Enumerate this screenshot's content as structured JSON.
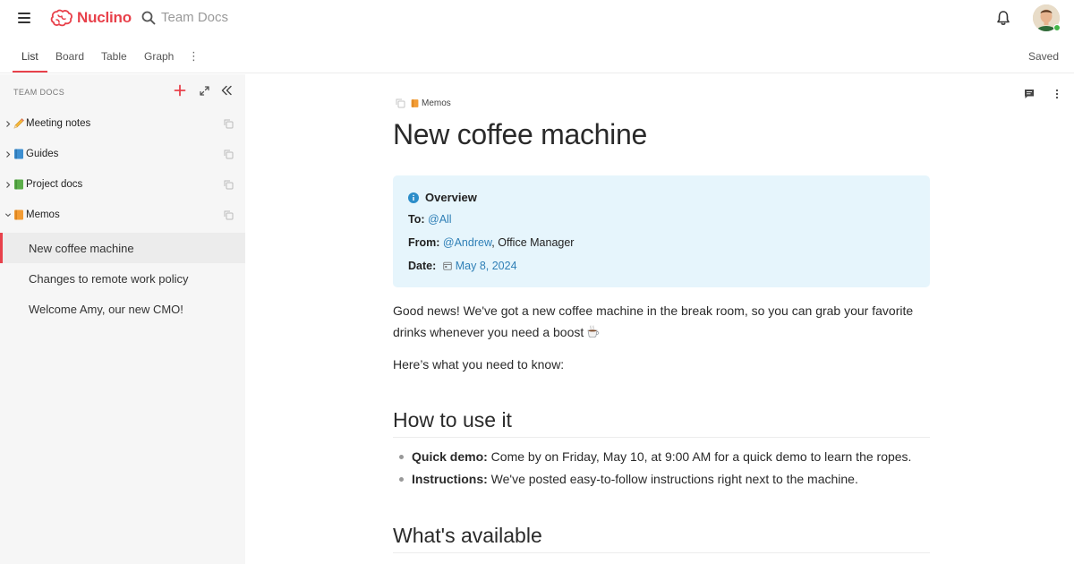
{
  "app": {
    "name": "Nuclino",
    "workspace": "Team Docs",
    "brand_color": "#e8414b"
  },
  "tabs": [
    {
      "label": "List",
      "active": true
    },
    {
      "label": "Board",
      "active": false
    },
    {
      "label": "Table",
      "active": false
    },
    {
      "label": "Graph",
      "active": false
    }
  ],
  "tabs_more": "⋮",
  "save_status": "Saved",
  "sidebar": {
    "title": "TEAM DOCS",
    "collections": [
      {
        "label": "Meeting notes",
        "icon": "pencil-icon",
        "expanded": false
      },
      {
        "label": "Guides",
        "icon": "blue-book-icon",
        "expanded": false
      },
      {
        "label": "Project docs",
        "icon": "green-book-icon",
        "expanded": false
      },
      {
        "label": "Memos",
        "icon": "orange-book-icon",
        "expanded": true
      }
    ],
    "memos": [
      {
        "label": "New coffee machine",
        "active": true
      },
      {
        "label": "Changes to remote work policy",
        "active": false
      },
      {
        "label": "Welcome Amy, our new CMO!",
        "active": false
      }
    ]
  },
  "doc": {
    "breadcrumb": "Memos",
    "title": "New coffee machine",
    "callout": {
      "title": "Overview",
      "to_label": "To:",
      "to_value": "@All",
      "from_label": "From:",
      "from_mention": "@Andrew",
      "from_rest": ", Office Manager",
      "date_label": "Date:",
      "date_value": "May 8, 2024"
    },
    "intro": "Good news! We've got a new coffee machine in the break room, so you can grab your favorite drinks whenever you need a boost",
    "intro2": "Here’s what you need to know:",
    "section1": {
      "heading": "How to use it",
      "bullets": [
        {
          "bold": "Quick demo:",
          "text": " Come by on Friday, May 10, at 9:00 AM for a quick demo to learn the ropes."
        },
        {
          "bold": "Instructions:",
          "text": " We've posted easy-to-follow instructions right next to the machine."
        }
      ]
    },
    "section2": {
      "heading": "What's available"
    }
  }
}
